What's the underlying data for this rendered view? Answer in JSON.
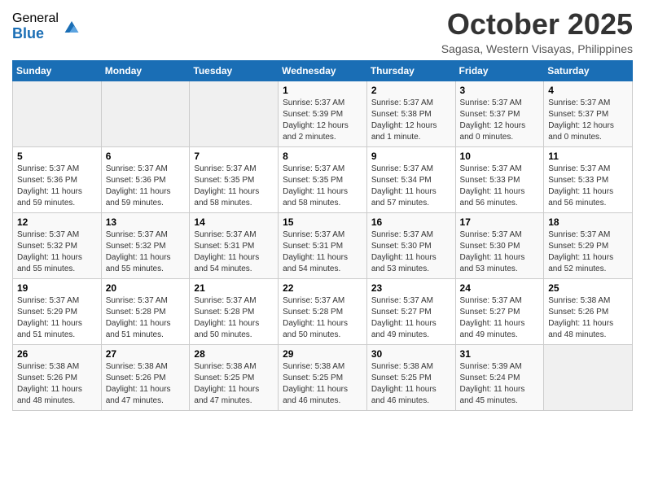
{
  "logo": {
    "general": "General",
    "blue": "Blue"
  },
  "title": "October 2025",
  "location": "Sagasa, Western Visayas, Philippines",
  "days_header": [
    "Sunday",
    "Monday",
    "Tuesday",
    "Wednesday",
    "Thursday",
    "Friday",
    "Saturday"
  ],
  "weeks": [
    [
      {
        "day": "",
        "info": ""
      },
      {
        "day": "",
        "info": ""
      },
      {
        "day": "",
        "info": ""
      },
      {
        "day": "1",
        "info": "Sunrise: 5:37 AM\nSunset: 5:39 PM\nDaylight: 12 hours\nand 2 minutes."
      },
      {
        "day": "2",
        "info": "Sunrise: 5:37 AM\nSunset: 5:38 PM\nDaylight: 12 hours\nand 1 minute."
      },
      {
        "day": "3",
        "info": "Sunrise: 5:37 AM\nSunset: 5:37 PM\nDaylight: 12 hours\nand 0 minutes."
      },
      {
        "day": "4",
        "info": "Sunrise: 5:37 AM\nSunset: 5:37 PM\nDaylight: 12 hours\nand 0 minutes."
      }
    ],
    [
      {
        "day": "5",
        "info": "Sunrise: 5:37 AM\nSunset: 5:36 PM\nDaylight: 11 hours\nand 59 minutes."
      },
      {
        "day": "6",
        "info": "Sunrise: 5:37 AM\nSunset: 5:36 PM\nDaylight: 11 hours\nand 59 minutes."
      },
      {
        "day": "7",
        "info": "Sunrise: 5:37 AM\nSunset: 5:35 PM\nDaylight: 11 hours\nand 58 minutes."
      },
      {
        "day": "8",
        "info": "Sunrise: 5:37 AM\nSunset: 5:35 PM\nDaylight: 11 hours\nand 58 minutes."
      },
      {
        "day": "9",
        "info": "Sunrise: 5:37 AM\nSunset: 5:34 PM\nDaylight: 11 hours\nand 57 minutes."
      },
      {
        "day": "10",
        "info": "Sunrise: 5:37 AM\nSunset: 5:33 PM\nDaylight: 11 hours\nand 56 minutes."
      },
      {
        "day": "11",
        "info": "Sunrise: 5:37 AM\nSunset: 5:33 PM\nDaylight: 11 hours\nand 56 minutes."
      }
    ],
    [
      {
        "day": "12",
        "info": "Sunrise: 5:37 AM\nSunset: 5:32 PM\nDaylight: 11 hours\nand 55 minutes."
      },
      {
        "day": "13",
        "info": "Sunrise: 5:37 AM\nSunset: 5:32 PM\nDaylight: 11 hours\nand 55 minutes."
      },
      {
        "day": "14",
        "info": "Sunrise: 5:37 AM\nSunset: 5:31 PM\nDaylight: 11 hours\nand 54 minutes."
      },
      {
        "day": "15",
        "info": "Sunrise: 5:37 AM\nSunset: 5:31 PM\nDaylight: 11 hours\nand 54 minutes."
      },
      {
        "day": "16",
        "info": "Sunrise: 5:37 AM\nSunset: 5:30 PM\nDaylight: 11 hours\nand 53 minutes."
      },
      {
        "day": "17",
        "info": "Sunrise: 5:37 AM\nSunset: 5:30 PM\nDaylight: 11 hours\nand 53 minutes."
      },
      {
        "day": "18",
        "info": "Sunrise: 5:37 AM\nSunset: 5:29 PM\nDaylight: 11 hours\nand 52 minutes."
      }
    ],
    [
      {
        "day": "19",
        "info": "Sunrise: 5:37 AM\nSunset: 5:29 PM\nDaylight: 11 hours\nand 51 minutes."
      },
      {
        "day": "20",
        "info": "Sunrise: 5:37 AM\nSunset: 5:28 PM\nDaylight: 11 hours\nand 51 minutes."
      },
      {
        "day": "21",
        "info": "Sunrise: 5:37 AM\nSunset: 5:28 PM\nDaylight: 11 hours\nand 50 minutes."
      },
      {
        "day": "22",
        "info": "Sunrise: 5:37 AM\nSunset: 5:28 PM\nDaylight: 11 hours\nand 50 minutes."
      },
      {
        "day": "23",
        "info": "Sunrise: 5:37 AM\nSunset: 5:27 PM\nDaylight: 11 hours\nand 49 minutes."
      },
      {
        "day": "24",
        "info": "Sunrise: 5:37 AM\nSunset: 5:27 PM\nDaylight: 11 hours\nand 49 minutes."
      },
      {
        "day": "25",
        "info": "Sunrise: 5:38 AM\nSunset: 5:26 PM\nDaylight: 11 hours\nand 48 minutes."
      }
    ],
    [
      {
        "day": "26",
        "info": "Sunrise: 5:38 AM\nSunset: 5:26 PM\nDaylight: 11 hours\nand 48 minutes."
      },
      {
        "day": "27",
        "info": "Sunrise: 5:38 AM\nSunset: 5:26 PM\nDaylight: 11 hours\nand 47 minutes."
      },
      {
        "day": "28",
        "info": "Sunrise: 5:38 AM\nSunset: 5:25 PM\nDaylight: 11 hours\nand 47 minutes."
      },
      {
        "day": "29",
        "info": "Sunrise: 5:38 AM\nSunset: 5:25 PM\nDaylight: 11 hours\nand 46 minutes."
      },
      {
        "day": "30",
        "info": "Sunrise: 5:38 AM\nSunset: 5:25 PM\nDaylight: 11 hours\nand 46 minutes."
      },
      {
        "day": "31",
        "info": "Sunrise: 5:39 AM\nSunset: 5:24 PM\nDaylight: 11 hours\nand 45 minutes."
      },
      {
        "day": "",
        "info": ""
      }
    ]
  ]
}
